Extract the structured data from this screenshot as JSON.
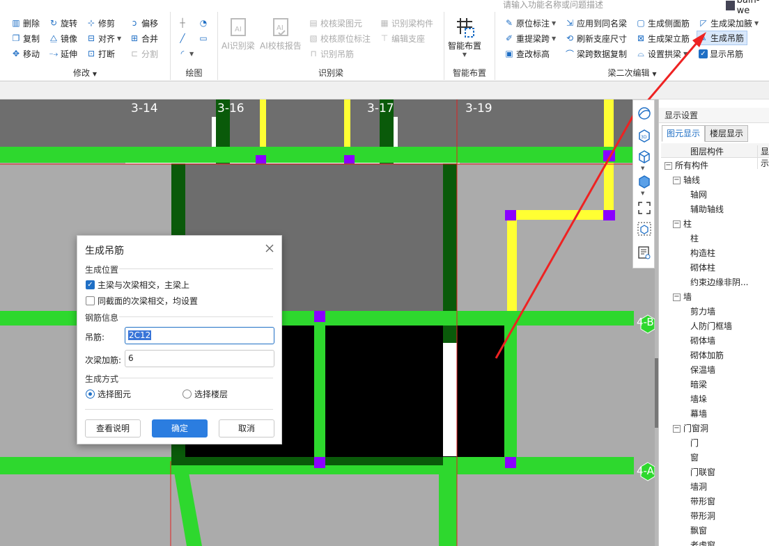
{
  "topbar": {
    "search_placeholder": "请输入功能名称或问题描述",
    "user_name": "bain-we"
  },
  "ribbon": {
    "modify": {
      "title": "修改",
      "col1": [
        "删除",
        "复制",
        "移动"
      ],
      "col2": [
        "旋转",
        "镜像",
        "延伸"
      ],
      "col3": [
        "修剪",
        "对齐",
        "打断"
      ],
      "col4": [
        "偏移",
        "合并",
        "分割"
      ]
    },
    "draw": {
      "title": "绘图"
    },
    "recognize_beam": {
      "title": "识别梁",
      "ai_recognize": "AI识别梁",
      "ai_check": "AI校核报告",
      "check_beam": "校核梁图元",
      "check_origin": "校核原位标注",
      "recognize_hanger": "识别吊筋",
      "recognize_member": "识别梁构件",
      "edit_support": "编辑支座"
    },
    "smart": {
      "title": "智能布置",
      "label": "智能布置"
    },
    "beam2": {
      "title": "梁二次编辑",
      "items_col1": [
        "原位标注",
        "重提梁跨",
        "查改标高"
      ],
      "items_col2": [
        "应用到同名梁",
        "刷新支座尺寸",
        "梁跨数据复制"
      ],
      "items_col3": [
        "生成侧面筋",
        "生成架立筋",
        "设置拱梁"
      ],
      "items_col4": [
        "生成梁加腋",
        "生成吊筋",
        "显示吊筋"
      ]
    }
  },
  "canvas": {
    "axis_labels": [
      "3-14",
      "3-16",
      "3-17",
      "3-19"
    ],
    "row_labels": [
      "4-B",
      "4-A"
    ]
  },
  "right_panel": {
    "title": "显示设置",
    "tabs": [
      "图元显示",
      "楼层显示"
    ],
    "col_header": "图层构件",
    "col_header2": "显示",
    "tree": [
      {
        "label": "所有构件",
        "level": 0,
        "toggle": "−"
      },
      {
        "label": "轴线",
        "level": 1,
        "toggle": "−"
      },
      {
        "label": "轴网",
        "level": 2
      },
      {
        "label": "辅助轴线",
        "level": 2
      },
      {
        "label": "柱",
        "level": 1,
        "toggle": "−"
      },
      {
        "label": "柱",
        "level": 2
      },
      {
        "label": "构造柱",
        "level": 2
      },
      {
        "label": "砌体柱",
        "level": 2
      },
      {
        "label": "约束边缘非阴...",
        "level": 2
      },
      {
        "label": "墙",
        "level": 1,
        "toggle": "−"
      },
      {
        "label": "剪力墙",
        "level": 2
      },
      {
        "label": "人防门框墙",
        "level": 2
      },
      {
        "label": "砌体墙",
        "level": 2
      },
      {
        "label": "砌体加筋",
        "level": 2
      },
      {
        "label": "保温墙",
        "level": 2
      },
      {
        "label": "暗梁",
        "level": 2
      },
      {
        "label": "墙垛",
        "level": 2
      },
      {
        "label": "幕墙",
        "level": 2
      },
      {
        "label": "门窗洞",
        "level": 1,
        "toggle": "−"
      },
      {
        "label": "门",
        "level": 2
      },
      {
        "label": "窗",
        "level": 2
      },
      {
        "label": "门联窗",
        "level": 2
      },
      {
        "label": "墙洞",
        "level": 2
      },
      {
        "label": "带形窗",
        "level": 2
      },
      {
        "label": "带形洞",
        "level": 2
      },
      {
        "label": "飘窗",
        "level": 2
      },
      {
        "label": "老虎窗",
        "level": 2
      }
    ]
  },
  "dialog": {
    "title": "生成吊筋",
    "section_position": "生成位置",
    "opt_main_secondary": "主梁与次梁相交，主梁上",
    "opt_same_section": "同截面的次梁相交，均设置",
    "section_rebar": "钢筋信息",
    "hanger_label": "吊筋:",
    "hanger_value": "2C12",
    "secondary_label": "次梁加筋:",
    "secondary_value": "6",
    "section_method": "生成方式",
    "radio_select_element": "选择图元",
    "radio_select_floor": "选择楼层",
    "btn_help": "查看说明",
    "btn_ok": "确定",
    "btn_cancel": "取消"
  },
  "colors": {
    "beam_green": "#2ed82e",
    "dark_green": "#0a5a0a",
    "yellow_beam": "#ffff33",
    "support_purple": "#8a00ff",
    "axis_red": "#e02020",
    "accent_blue": "#2b7de0"
  }
}
